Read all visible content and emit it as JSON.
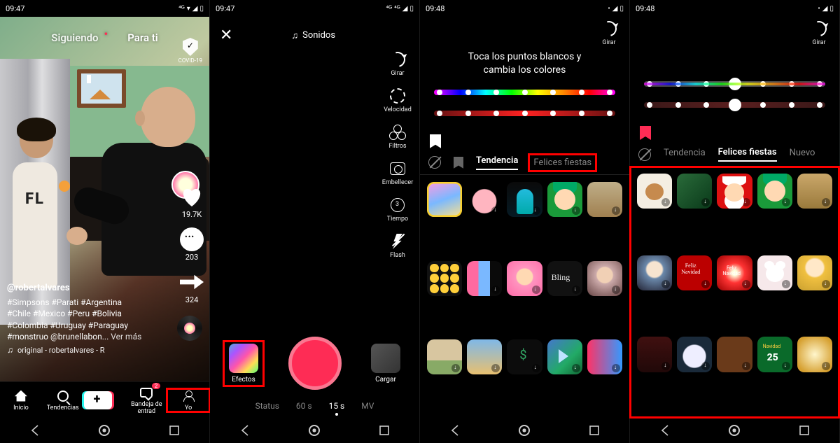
{
  "screens": [
    {
      "statusbar": {
        "time": "09:47",
        "indicators": "4G ◢ ▯"
      },
      "feed": {
        "tabs": {
          "following": "Siguiendo",
          "for_you": "Para ti"
        },
        "covid_label": "COVID-19",
        "counts": {
          "likes": "19.7K",
          "comments": "203",
          "shares": "324"
        },
        "username": "@robertalvares",
        "hashtags_line1": "#Simpsons #Parati #Argentina",
        "hashtags_line2": "#Chile #Mexico #Peru #Bolivia",
        "hashtags_line3": "#Colombia #Uruguay #Paraguay",
        "hashtags_line4": "#monstruo @brunellabon...",
        "see_more": "Ver más",
        "sound": "original - robertalvares - R",
        "bottom_tabs": {
          "home": "Inicio",
          "trends": "Tendencias",
          "inbox": "Bandeja de entrad",
          "inbox_badge": "2",
          "me": "Yo"
        }
      }
    },
    {
      "statusbar": {
        "time": "09:47",
        "indicators": "4G 4G ◢ ▯"
      },
      "camera": {
        "sounds": "Sonidos",
        "controls": {
          "flip": "Girar",
          "speed": "Velocidad",
          "filters": "Filtros",
          "beauty": "Embellecer",
          "timer": "Tiempo",
          "flash": "Flash"
        },
        "effects_label": "Efectos",
        "upload_label": "Cargar",
        "modes": {
          "status": "Status",
          "sixty": "60 s",
          "fifteen": "15 s",
          "mv": "MV"
        }
      }
    },
    {
      "statusbar": {
        "time": "09:48",
        "indicators": "◢ ▯"
      },
      "effects": {
        "flip": "Girar",
        "instruction": "Toca los puntos blancos y\ncambia los colores",
        "tabs": {
          "trend": "Tendencia",
          "holidays": "Felices fiestas"
        }
      }
    },
    {
      "statusbar": {
        "time": "09:48",
        "indicators": "◢ ▯"
      },
      "effects": {
        "flip": "Girar",
        "tabs": {
          "trend": "Tendencia",
          "holidays": "Felices fiestas",
          "new": "Nuevo"
        }
      }
    }
  ]
}
